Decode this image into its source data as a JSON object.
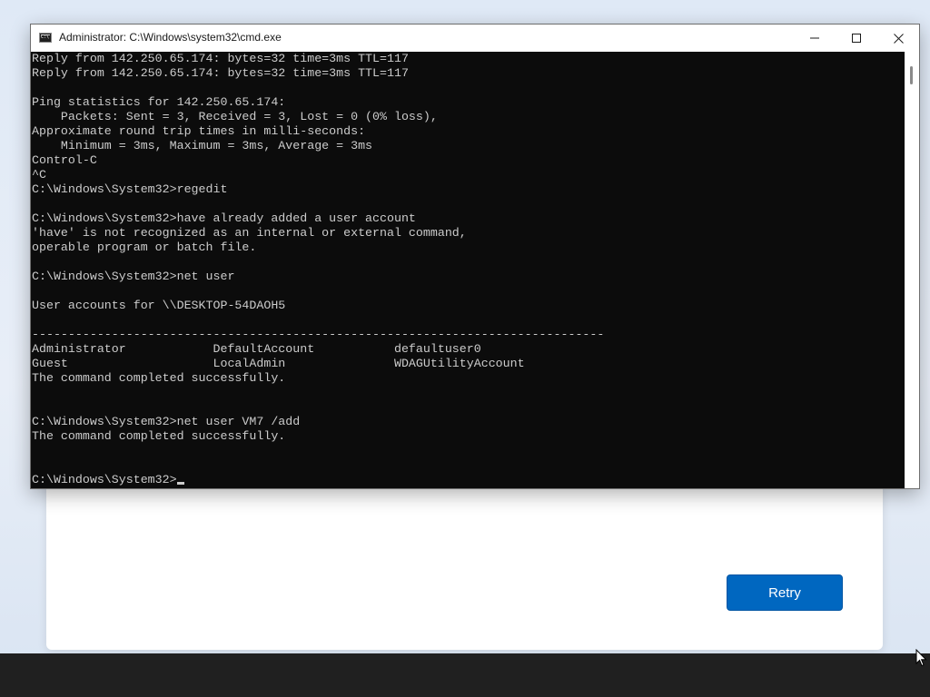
{
  "window": {
    "title": "Administrator: C:\\Windows\\system32\\cmd.exe",
    "icon": "cmd-icon"
  },
  "controls": {
    "minimize_icon": "minimize-icon",
    "maximize_icon": "maximize-icon",
    "close_icon": "close-icon"
  },
  "console": {
    "lines": [
      "Reply from 142.250.65.174: bytes=32 time=3ms TTL=117",
      "Reply from 142.250.65.174: bytes=32 time=3ms TTL=117",
      "",
      "Ping statistics for 142.250.65.174:",
      "    Packets: Sent = 3, Received = 3, Lost = 0 (0% loss),",
      "Approximate round trip times in milli-seconds:",
      "    Minimum = 3ms, Maximum = 3ms, Average = 3ms",
      "Control-C",
      "^C",
      "C:\\Windows\\System32>regedit",
      "",
      "C:\\Windows\\System32>have already added a user account",
      "'have' is not recognized as an internal or external command,",
      "operable program or batch file.",
      "",
      "C:\\Windows\\System32>net user",
      "",
      "User accounts for \\\\DESKTOP-54DAOH5",
      "",
      "-------------------------------------------------------------------------------",
      "Administrator            DefaultAccount           defaultuser0",
      "Guest                    LocalAdmin               WDAGUtilityAccount",
      "The command completed successfully.",
      "",
      "",
      "C:\\Windows\\System32>net user VM7 /add",
      "The command completed successfully.",
      "",
      ""
    ],
    "prompt": "C:\\Windows\\System32>"
  },
  "dialog": {
    "retry_label": "Retry"
  },
  "colors": {
    "console_bg": "#0c0c0c",
    "console_fg": "#cccccc",
    "accent": "#0067c0",
    "taskbar": "#202020"
  }
}
